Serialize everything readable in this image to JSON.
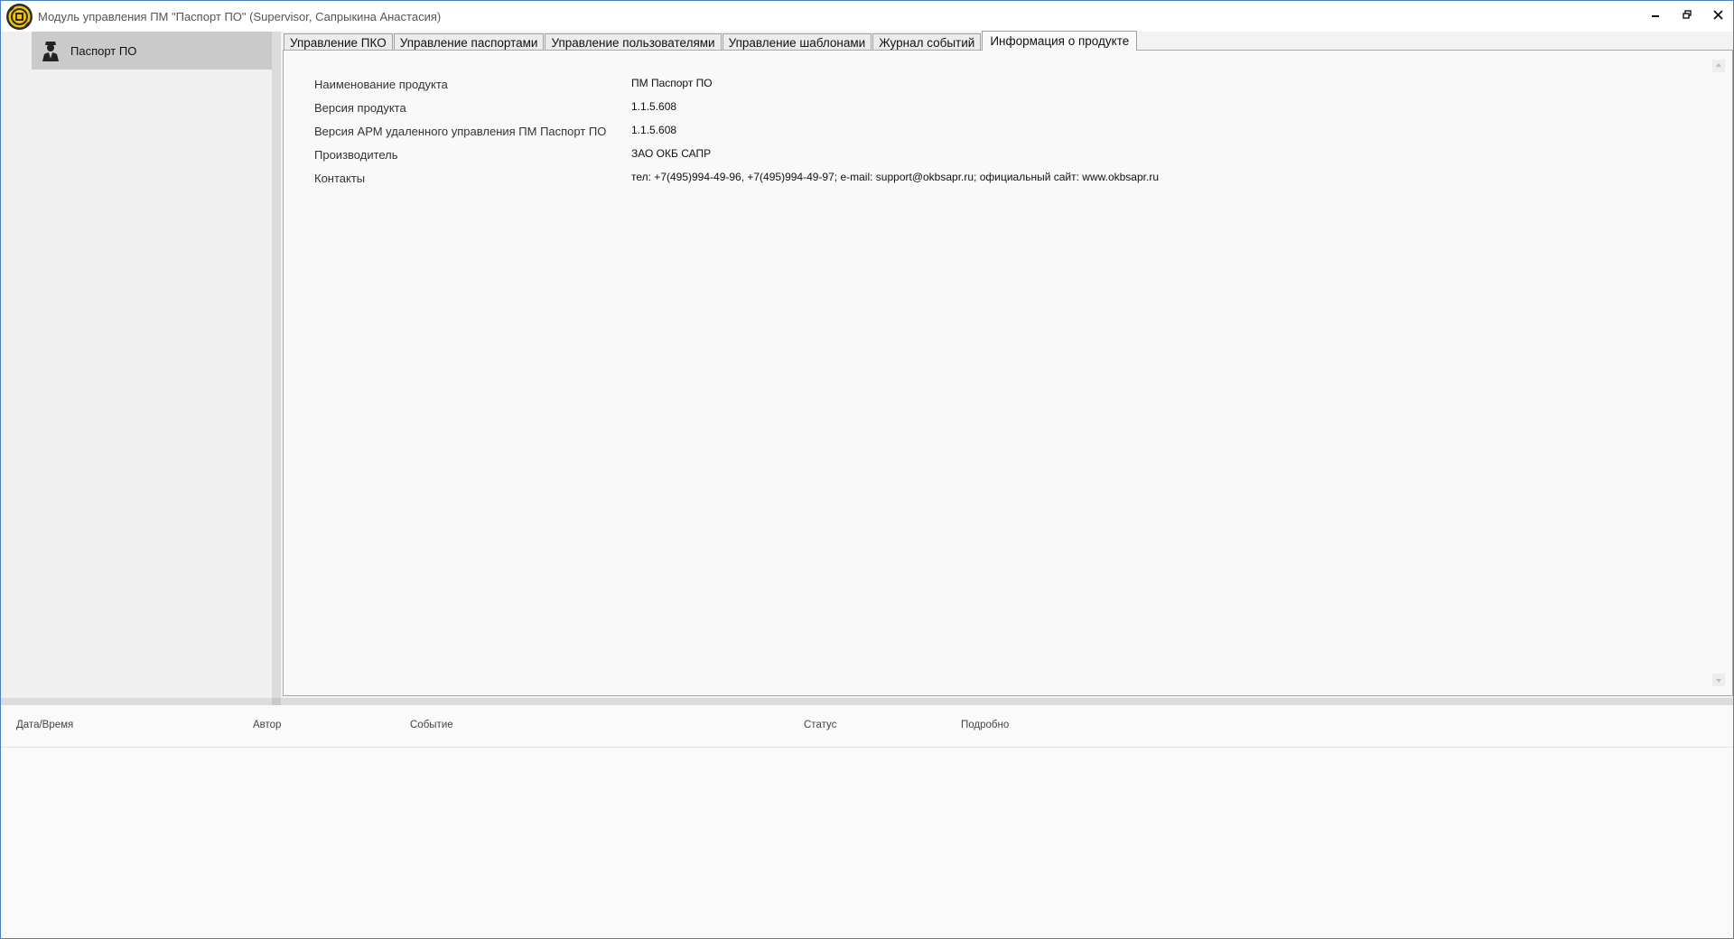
{
  "window": {
    "title": "Модуль управления ПМ \"Паспорт ПО\" (Supervisor, Сапрыкина Анастасия)",
    "icon": "app-logo-icon",
    "controls": [
      "minimize-icon",
      "restore-icon",
      "close-icon"
    ]
  },
  "sidebar": {
    "items": [
      {
        "label": "Паспорт ПО",
        "icon": "user-agent-icon",
        "selected": true
      }
    ]
  },
  "tabs": [
    {
      "label": "Управление ПКО",
      "active": false
    },
    {
      "label": "Управление паспортами",
      "active": false
    },
    {
      "label": "Управление пользователями",
      "active": false
    },
    {
      "label": "Управление шаблонами",
      "active": false
    },
    {
      "label": "Журнал событий",
      "active": false
    },
    {
      "label": "Информация о продукте",
      "active": true
    }
  ],
  "product_info": {
    "rows": [
      {
        "label": "Наименование продукта",
        "value": "ПМ Паспорт ПО"
      },
      {
        "label": "Версия продукта",
        "value": "1.1.5.608"
      },
      {
        "label": "Версия АРМ удаленного управления ПМ Паспорт ПО",
        "value": "1.1.5.608"
      },
      {
        "label": "Производитель",
        "value": "ЗАО ОКБ САПР"
      },
      {
        "label": "Контакты",
        "value": "тел: +7(495)994-49-96, +7(495)994-49-97; e-mail: support@okbsapr.ru; официальный сайт: www.okbsapr.ru"
      }
    ]
  },
  "events": {
    "columns": [
      "Дата/Время",
      "Автор",
      "Событие",
      "Статус",
      "Подробно"
    ]
  },
  "colors": {
    "window_border": "#4a7fc4",
    "sidebar_selected": "#cacaca",
    "logo_yellow": "#f5c400"
  }
}
